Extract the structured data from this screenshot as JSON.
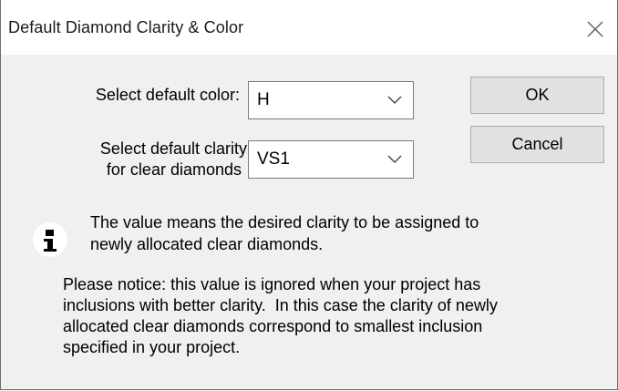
{
  "dialog": {
    "title": "Default Diamond Clarity & Color",
    "close_symbol": "×"
  },
  "form": {
    "color_label": "Select default color:",
    "color_value": "H",
    "clarity_label_line1": "Select default clarity",
    "clarity_label_line2": "for clear diamonds",
    "clarity_value": "VS1"
  },
  "buttons": {
    "ok": "OK",
    "cancel": "Cancel"
  },
  "info": {
    "icon": "info-icon",
    "line1": "The value means the desired clarity to be assigned to",
    "line2": "newly allocated clear diamonds."
  },
  "notice": {
    "line1": "Please notice: this value is ignored when your project has",
    "line2": "inclusions with better clarity.  In this case the clarity of newly",
    "line3": "allocated clear diamonds correspond to smallest inclusion",
    "line4": "specified in your project."
  }
}
